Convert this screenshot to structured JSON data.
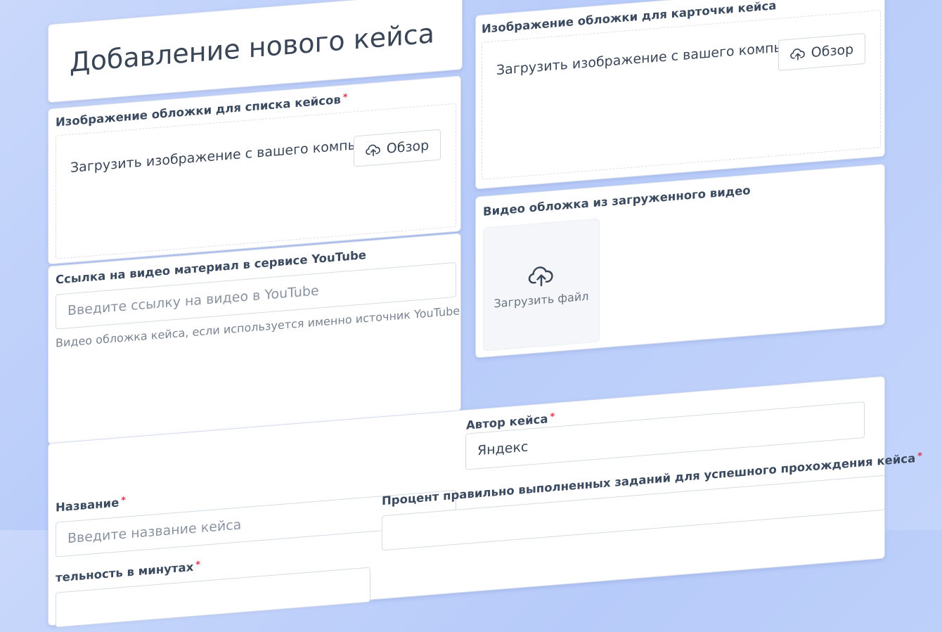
{
  "page": {
    "title": "Добавление нового кейса"
  },
  "cover_list": {
    "label": "Изображение обложки для списка кейсов",
    "required_mark": "*",
    "upload_text": "Загрузить изображение с вашего компьютера:",
    "browse_label": "Обзор",
    "browse_icon": "cloud-upload-icon"
  },
  "cover_card": {
    "label": "Изображение обложки для карточки кейса",
    "upload_text": "Загрузить изображение с вашего компьютера:",
    "browse_label": "Обзор",
    "browse_icon": "cloud-upload-icon"
  },
  "youtube": {
    "label": "Ссылка на видео материал в сервисе YouTube",
    "placeholder": "Введите ссылку на видео в YouTube",
    "help": "Видео обложка кейса, если используется именно источник YouTube"
  },
  "video_cover": {
    "label": "Видео обложка из загруженного видео",
    "dropzone_text": "Загрузить файл",
    "dropzone_icon": "cloud-upload-icon"
  },
  "author": {
    "label": "Автор кейса",
    "required_mark": "*",
    "value": "Яндекс"
  },
  "name": {
    "label": "Название",
    "required_mark": "*",
    "placeholder": "Введите название кейса"
  },
  "percent": {
    "label": "Процент правильно выполненных заданий для успешного прохождения кейса",
    "required_mark": "*"
  },
  "duration": {
    "label": "тельность в минутах",
    "required_mark": "*"
  },
  "colors": {
    "background": "#c4d5fb",
    "card": "#ffffff",
    "required": "#e0334c",
    "label": "#3b4a5e"
  }
}
